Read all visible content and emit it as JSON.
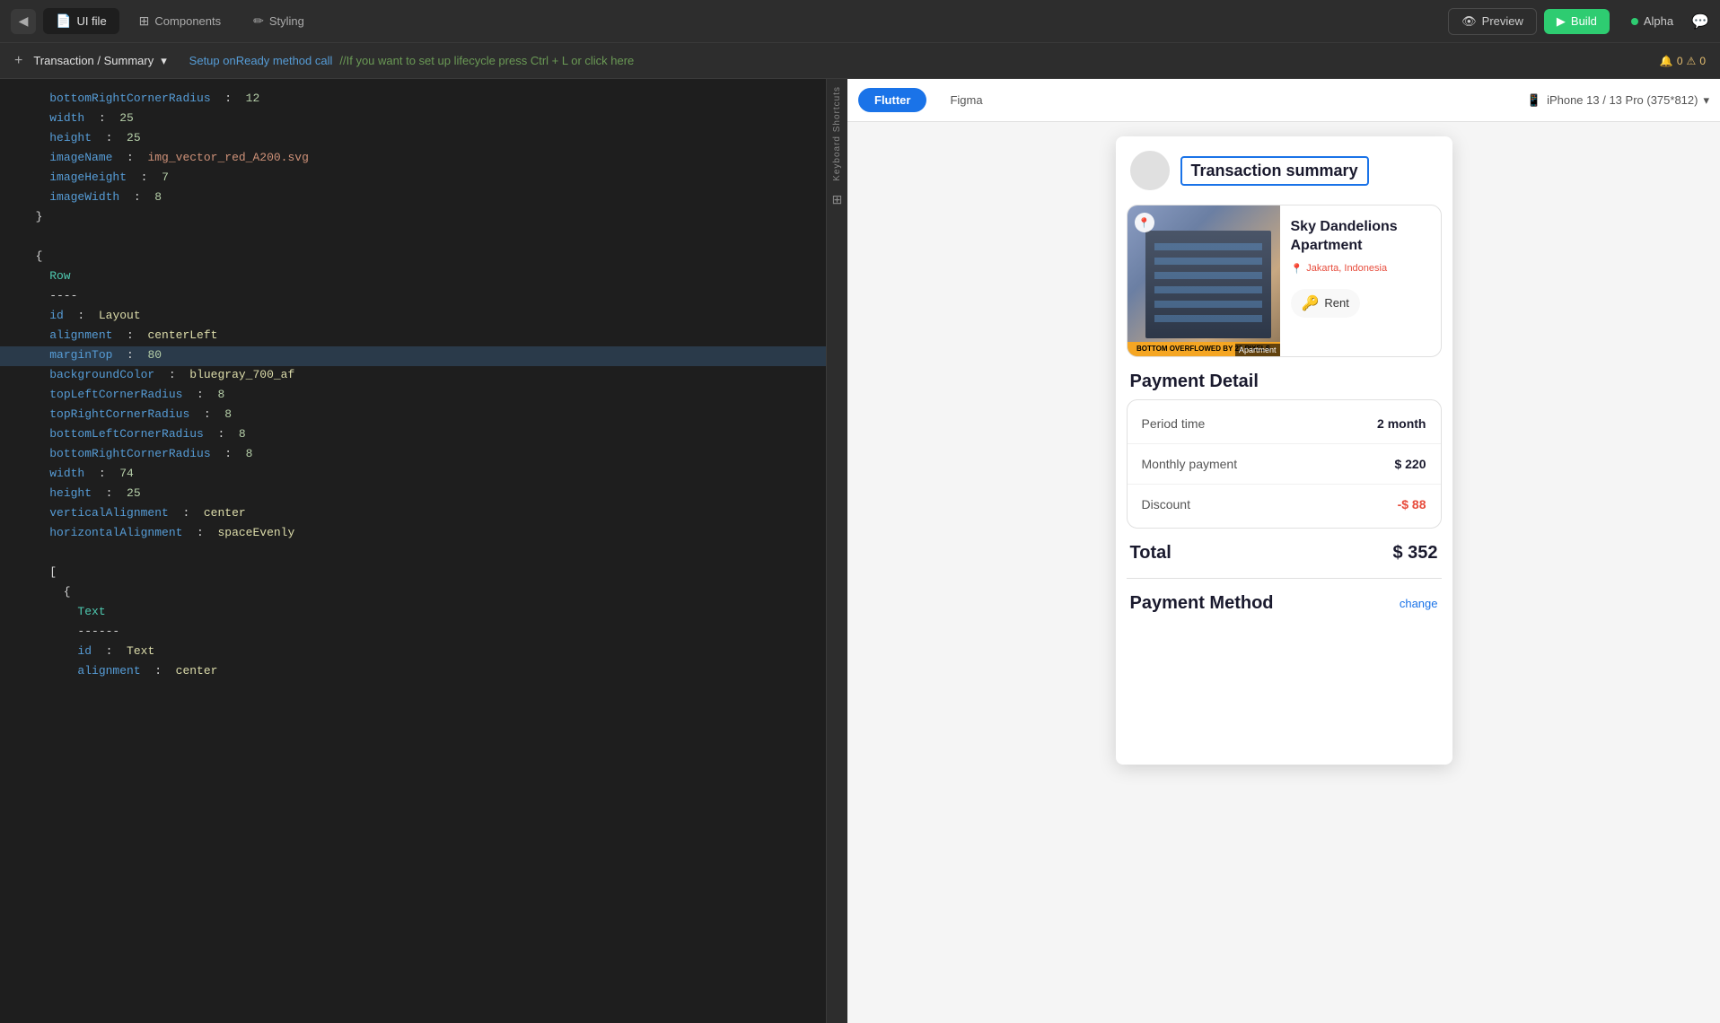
{
  "topbar": {
    "back_icon": "◀",
    "tabs": [
      {
        "label": "UI file",
        "icon": "📄",
        "active": true
      },
      {
        "label": "Components",
        "icon": "⊞",
        "active": false
      },
      {
        "label": "Styling",
        "icon": "✏",
        "active": false
      }
    ],
    "preview_label": "Preview",
    "build_label": "Build",
    "preview_icon": "👁",
    "build_icon": "▶",
    "user_name": "Alpha",
    "online_status": "online"
  },
  "breadcrumb": {
    "plus_label": "+",
    "path": "Transaction / Summary",
    "dropdown_icon": "▾",
    "setup_comment": "Setup onReady method call",
    "hint_comment": "//If you want to set up lifecycle press Ctrl + L or click here",
    "warning_count": "0",
    "error_count": "0"
  },
  "code": {
    "lines": [
      {
        "text": "    bottomRightCornerRadius  :  12",
        "highlight": false
      },
      {
        "text": "    width  :  25",
        "highlight": false
      },
      {
        "text": "    height  :  25",
        "highlight": false
      },
      {
        "text": "    imageName  :  img_vector_red_A200.svg",
        "highlight": false
      },
      {
        "text": "    imageHeight  :  7",
        "highlight": false
      },
      {
        "text": "    imageWidth  :  8",
        "highlight": false
      },
      {
        "text": "  }",
        "highlight": false
      },
      {
        "text": "",
        "highlight": false
      },
      {
        "text": "  {",
        "highlight": false
      },
      {
        "text": "    Row",
        "highlight": false
      },
      {
        "text": "    ----",
        "highlight": false
      },
      {
        "text": "    id  :  Layout",
        "highlight": false
      },
      {
        "text": "    alignment  :  centerLeft",
        "highlight": false
      },
      {
        "text": "    marginTop  :  80",
        "highlight": true
      },
      {
        "text": "    backgroundColor  :  bluegray_700_af",
        "highlight": false
      },
      {
        "text": "    topLeftCornerRadius  :  8",
        "highlight": false
      },
      {
        "text": "    topRightCornerRadius  :  8",
        "highlight": false
      },
      {
        "text": "    bottomLeftCornerRadius  :  8",
        "highlight": false
      },
      {
        "text": "    bottomRightCornerRadius  :  8",
        "highlight": false
      },
      {
        "text": "    width  :  74",
        "highlight": false
      },
      {
        "text": "    height  :  25",
        "highlight": false
      },
      {
        "text": "    verticalAlignment  :  center",
        "highlight": false
      },
      {
        "text": "    horizontalAlignment  :  spaceEvenly",
        "highlight": false
      },
      {
        "text": "",
        "highlight": false
      },
      {
        "text": "    [",
        "highlight": false
      },
      {
        "text": "      {",
        "highlight": false
      },
      {
        "text": "        Text",
        "highlight": false
      },
      {
        "text": "        ------",
        "highlight": false
      },
      {
        "text": "        id  :  Text",
        "highlight": false
      },
      {
        "text": "        alignment  :  center",
        "highlight": false
      }
    ]
  },
  "preview": {
    "flutter_label": "Flutter",
    "figma_label": "Figma",
    "device_label": "iPhone 13 / 13 Pro (375*812)",
    "phone_icon": "📱",
    "dropdown_icon": "▾"
  },
  "app": {
    "title": "Transaction summary",
    "property": {
      "name": "Sky Dandelions Apartment",
      "location": "Jakarta, Indonesia",
      "location_icon": "📍",
      "category": "Rent",
      "key_icon": "🔑",
      "overflow_warning": "BOTTOM OVERFLOWED BY 22 PIXELS",
      "apt_label": "Apartment"
    },
    "payment_detail": {
      "section_title": "Payment Detail",
      "rows": [
        {
          "label": "Period time",
          "value": "2 month"
        },
        {
          "label": "Monthly payment",
          "value": "$ 220"
        },
        {
          "label": "Discount",
          "value": "-$ 88",
          "discount": true
        }
      ]
    },
    "total": {
      "label": "Total",
      "value": "$ 352"
    },
    "payment_method": {
      "title": "Payment Method",
      "change_label": "change"
    }
  },
  "kbd_sidebar": {
    "label": "Keyboard Shortcuts",
    "grid_icon": "⊞"
  }
}
